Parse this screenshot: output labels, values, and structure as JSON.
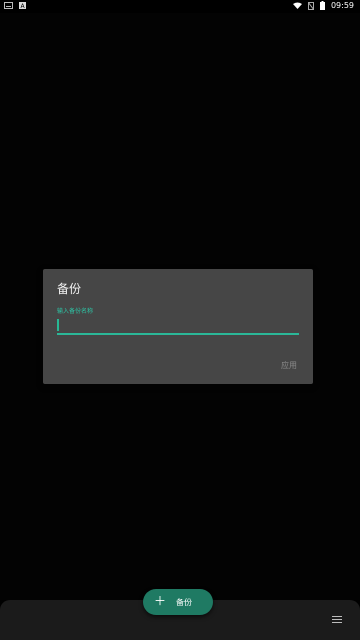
{
  "status_bar": {
    "time": "09:59",
    "icons": [
      "keyboard-icon",
      "a-notification-icon",
      "wifi-icon",
      "no-sim-icon",
      "battery-icon"
    ]
  },
  "dialog": {
    "title": "备份",
    "field_label": "输入备份名称",
    "field_value": "",
    "apply_label": "应用"
  },
  "fab": {
    "icon": "plus-icon",
    "label": "备份"
  },
  "bottom_bar": {
    "menu_icon": "menu-icon"
  },
  "colors": {
    "accent": "#2bb798",
    "dialog_bg": "#464646",
    "fab_bg": "#1f7a63",
    "bottom_bar_bg": "#1b1b1b"
  }
}
